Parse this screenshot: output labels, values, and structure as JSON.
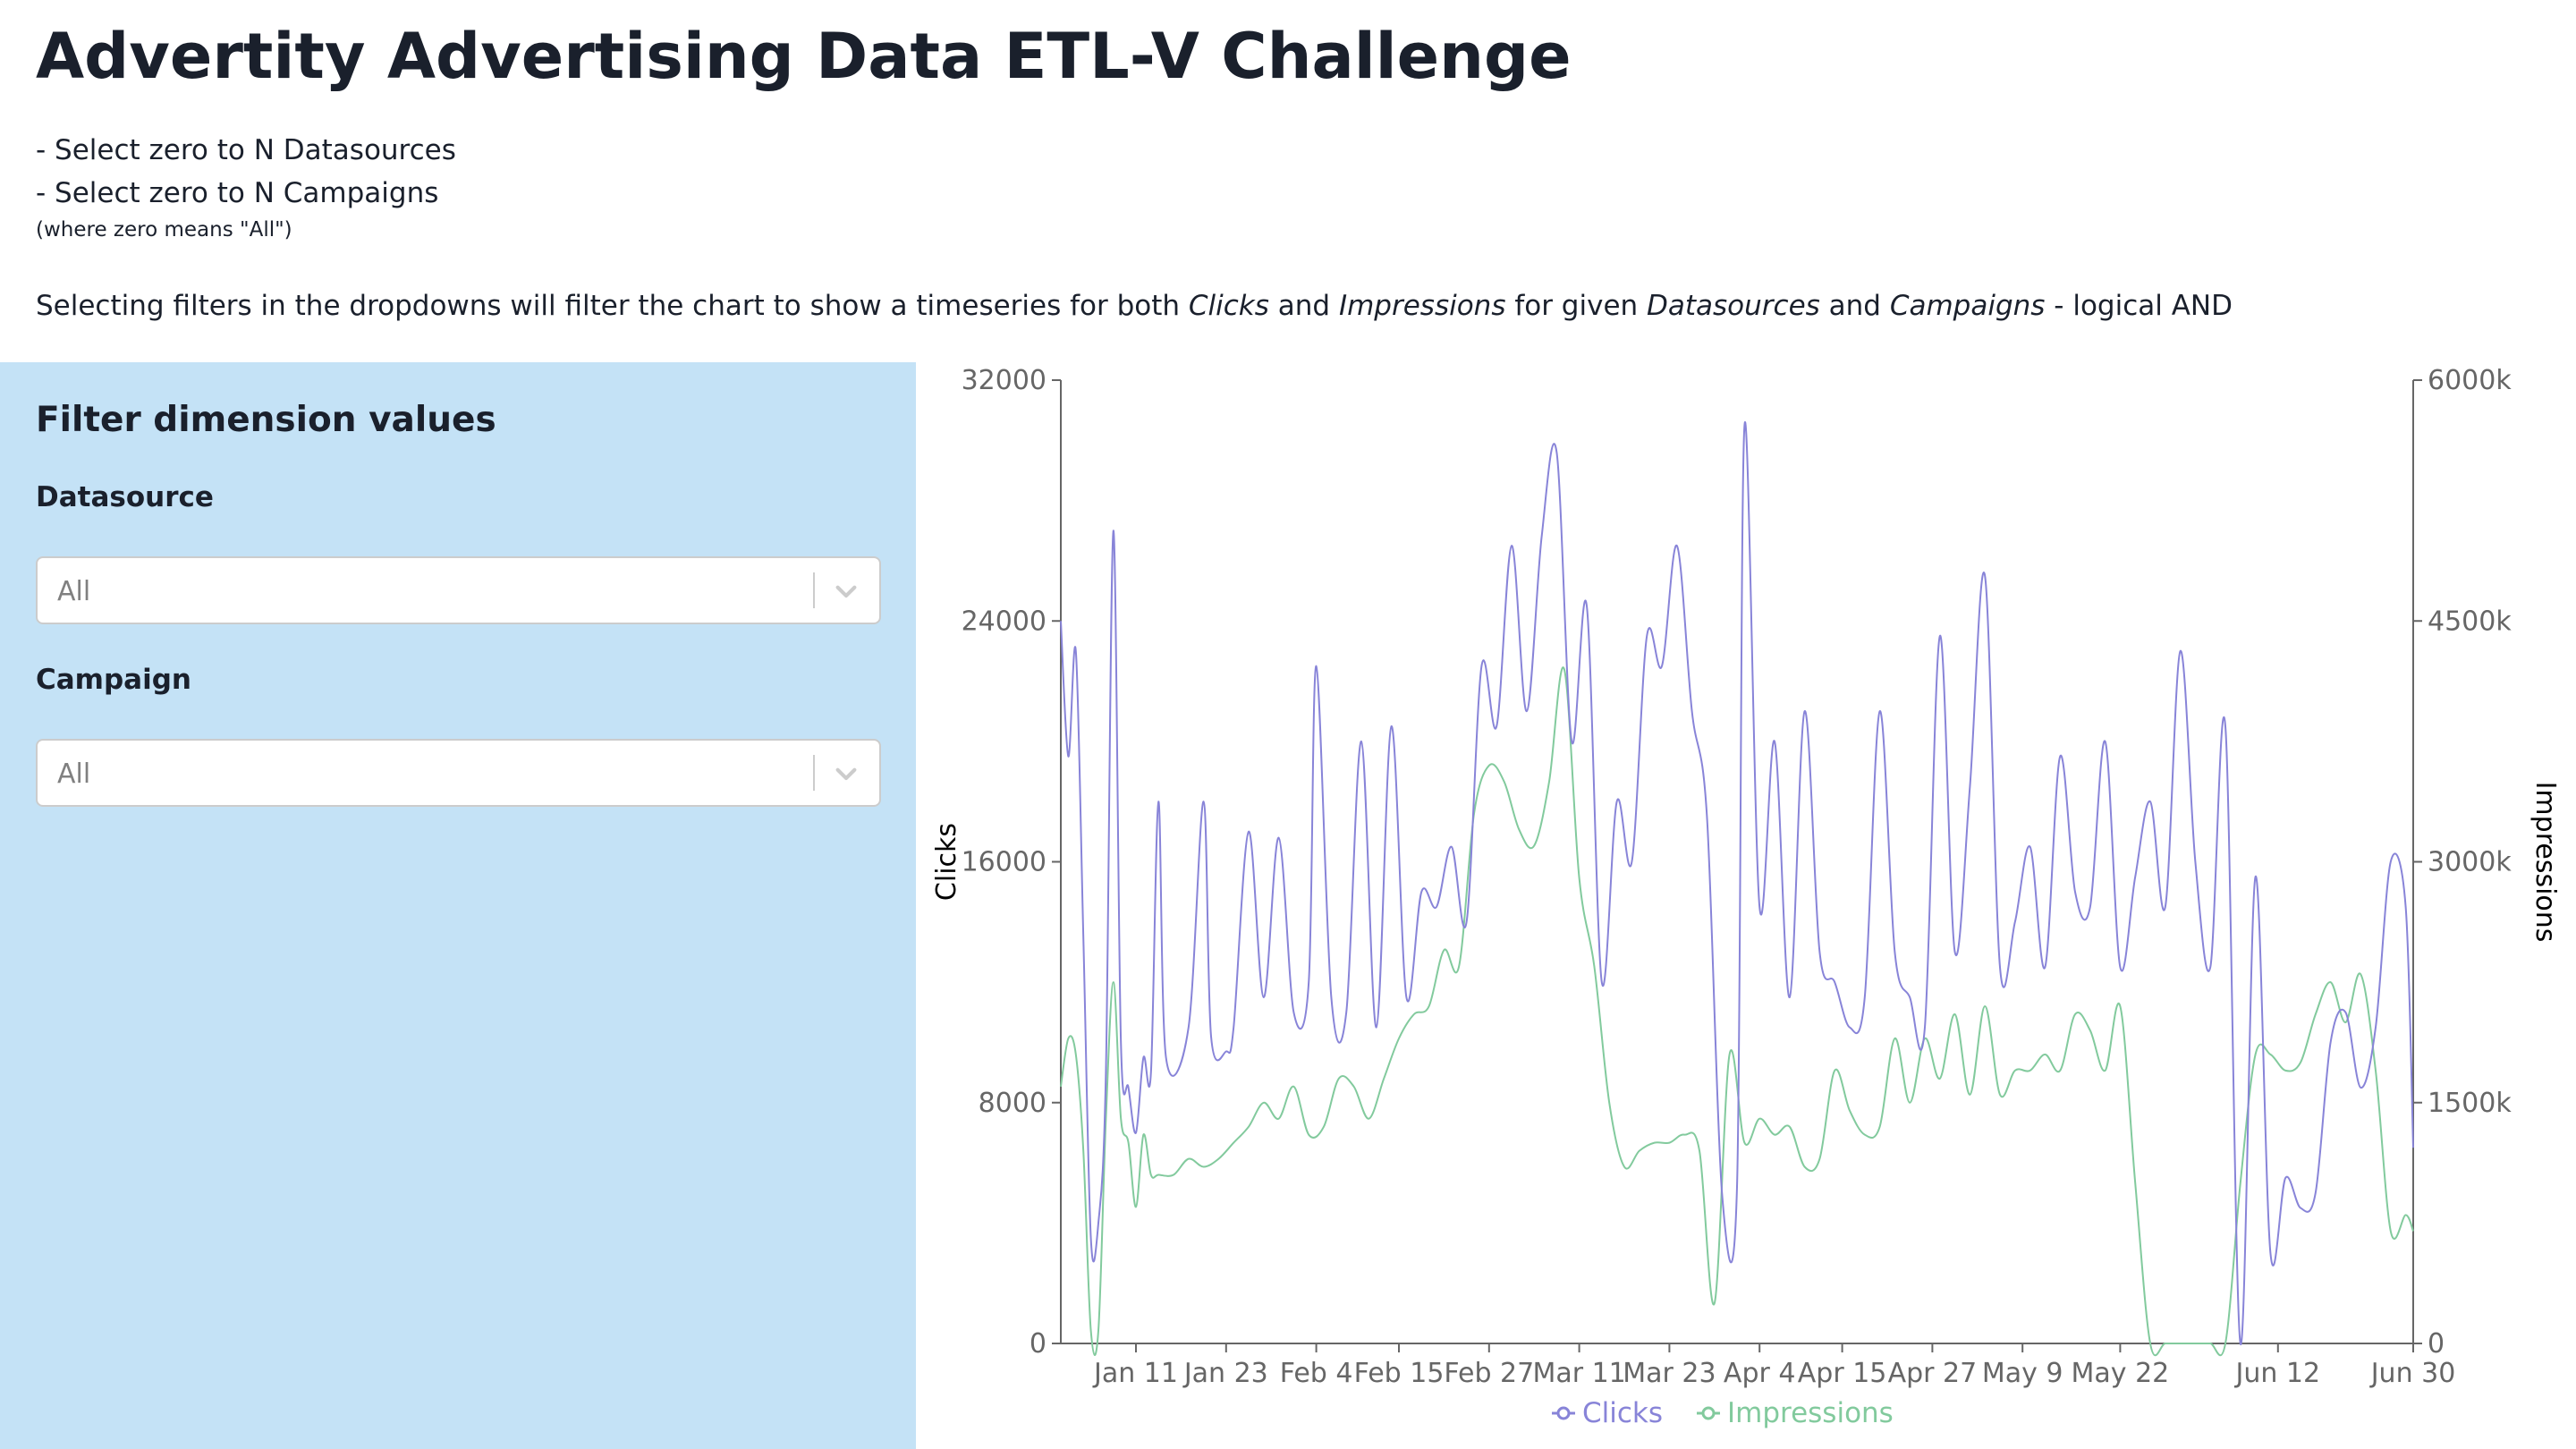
{
  "page": {
    "title": "Advertity Advertising Data ETL-V Challenge",
    "instructions": [
      "- Select zero to N Datasources",
      "- Select zero to N Campaigns"
    ],
    "note": "(where zero means \"All\")",
    "description": {
      "p1": "Selecting filters in the dropdowns will filter the chart to show a timeseries for both ",
      "clicks": "Clicks",
      "and1": " and ",
      "impressions": "Impressions",
      "p2": " for given ",
      "datasources": "Datasources",
      "and2": " and ",
      "campaigns": "Campaigns",
      "p3": " - logical AND"
    }
  },
  "sidebar": {
    "title": "Filter dimension values",
    "datasource": {
      "label": "Datasource",
      "value": "All"
    },
    "campaign": {
      "label": "Campaign",
      "value": "All"
    },
    "background": "#c4e2f6"
  },
  "icons": {
    "dropdown": "chevron-down-icon",
    "legend": "line-circle-marker-icon"
  },
  "chart_data": {
    "type": "line",
    "x_unit": "date (2019)",
    "x_ticks": [
      "Jan 11",
      "Jan 23",
      "Feb 4",
      "Feb 15",
      "Feb 27",
      "Mar 11",
      "Mar 23",
      "Apr 4",
      "Apr 15",
      "Apr 27",
      "May 9",
      "May 22",
      "Jun 12",
      "Jun 30"
    ],
    "x_tick_dates": [
      "2019-01-11",
      "2019-01-23",
      "2019-02-04",
      "2019-02-15",
      "2019-02-27",
      "2019-03-11",
      "2019-03-23",
      "2019-04-04",
      "2019-04-15",
      "2019-04-27",
      "2019-05-09",
      "2019-05-22",
      "2019-06-12",
      "2019-06-30"
    ],
    "xlim": [
      "2019-01-01",
      "2019-06-30"
    ],
    "y_left": {
      "label": "Clicks",
      "ylim": [
        0,
        32000
      ],
      "ticks": [
        "0",
        "8000",
        "16000",
        "24000",
        "32000"
      ]
    },
    "y_right": {
      "label": "Impressions",
      "ylim": [
        0,
        6000000
      ],
      "ticks": [
        "0",
        "1500k",
        "3000k",
        "4500k",
        "6000k"
      ]
    },
    "legend": "bottom-center",
    "grid": false,
    "series": [
      {
        "name": "Clicks",
        "axis": "left",
        "color": "#8884d8",
        "x": [
          "2019-01-01",
          "2019-01-02",
          "2019-01-03",
          "2019-01-04",
          "2019-01-05",
          "2019-01-06",
          "2019-01-07",
          "2019-01-08",
          "2019-01-09",
          "2019-01-10",
          "2019-01-11",
          "2019-01-12",
          "2019-01-13",
          "2019-01-14",
          "2019-01-15",
          "2019-01-18",
          "2019-01-20",
          "2019-01-21",
          "2019-01-23",
          "2019-01-24",
          "2019-01-26",
          "2019-01-28",
          "2019-01-30",
          "2019-02-01",
          "2019-02-03",
          "2019-02-04",
          "2019-02-06",
          "2019-02-08",
          "2019-02-10",
          "2019-02-12",
          "2019-02-14",
          "2019-02-16",
          "2019-02-18",
          "2019-02-20",
          "2019-02-22",
          "2019-02-24",
          "2019-02-26",
          "2019-02-28",
          "2019-03-02",
          "2019-03-04",
          "2019-03-06",
          "2019-03-08",
          "2019-03-10",
          "2019-03-12",
          "2019-03-14",
          "2019-03-16",
          "2019-03-18",
          "2019-03-20",
          "2019-03-22",
          "2019-03-24",
          "2019-03-26",
          "2019-03-28",
          "2019-03-30",
          "2019-04-01",
          "2019-04-02",
          "2019-04-04",
          "2019-04-06",
          "2019-04-08",
          "2019-04-10",
          "2019-04-12",
          "2019-04-14",
          "2019-04-16",
          "2019-04-18",
          "2019-04-20",
          "2019-04-22",
          "2019-04-24",
          "2019-04-26",
          "2019-04-28",
          "2019-04-30",
          "2019-05-02",
          "2019-05-04",
          "2019-05-06",
          "2019-05-08",
          "2019-05-10",
          "2019-05-12",
          "2019-05-14",
          "2019-05-16",
          "2019-05-18",
          "2019-05-20",
          "2019-05-22",
          "2019-05-24",
          "2019-05-26",
          "2019-05-28",
          "2019-05-30",
          "2019-06-01",
          "2019-06-03",
          "2019-06-05",
          "2019-06-07",
          "2019-06-09",
          "2019-06-11",
          "2019-06-13",
          "2019-06-15",
          "2019-06-17",
          "2019-06-19",
          "2019-06-21",
          "2019-06-23",
          "2019-06-25",
          "2019-06-27",
          "2019-06-29",
          "2019-06-30"
        ],
        "values": [
          24000,
          19500,
          23000,
          13500,
          3500,
          4000,
          9000,
          27000,
          10000,
          8500,
          7000,
          9500,
          9000,
          18000,
          9500,
          10500,
          18000,
          10200,
          9700,
          10500,
          17000,
          11500,
          16800,
          11000,
          12000,
          22500,
          11500,
          11000,
          20000,
          10500,
          20500,
          11500,
          15000,
          14500,
          16500,
          14000,
          22500,
          20500,
          26500,
          21000,
          26800,
          29600,
          20000,
          24500,
          12000,
          18000,
          16000,
          23500,
          22500,
          26500,
          21000,
          17500,
          5000,
          5200,
          30500,
          14500,
          20000,
          11500,
          21000,
          13000,
          12000,
          10500,
          11500,
          21000,
          13000,
          11500,
          10500,
          23500,
          13000,
          18500,
          25500,
          12500,
          14000,
          16500,
          12500,
          19500,
          15000,
          14500,
          20000,
          12500,
          15500,
          18000,
          14500,
          23000,
          16000,
          12500,
          20500,
          0,
          15500,
          3000,
          5500,
          4500,
          5000,
          10000,
          11000,
          8500,
          10500,
          16000,
          14500,
          6500
        ]
      },
      {
        "name": "Impressions",
        "axis": "right",
        "color": "#82ca9d",
        "x": [
          "2019-01-01",
          "2019-01-02",
          "2019-01-03",
          "2019-01-04",
          "2019-01-05",
          "2019-01-06",
          "2019-01-07",
          "2019-01-08",
          "2019-01-09",
          "2019-01-10",
          "2019-01-11",
          "2019-01-12",
          "2019-01-13",
          "2019-01-14",
          "2019-01-16",
          "2019-01-18",
          "2019-01-20",
          "2019-01-22",
          "2019-01-24",
          "2019-01-26",
          "2019-01-28",
          "2019-01-30",
          "2019-02-01",
          "2019-02-03",
          "2019-02-05",
          "2019-02-07",
          "2019-02-09",
          "2019-02-11",
          "2019-02-13",
          "2019-02-15",
          "2019-02-17",
          "2019-02-19",
          "2019-02-21",
          "2019-02-23",
          "2019-02-25",
          "2019-02-27",
          "2019-03-01",
          "2019-03-03",
          "2019-03-05",
          "2019-03-07",
          "2019-03-09",
          "2019-03-11",
          "2019-03-13",
          "2019-03-15",
          "2019-03-17",
          "2019-03-19",
          "2019-03-21",
          "2019-03-23",
          "2019-03-25",
          "2019-03-27",
          "2019-03-29",
          "2019-03-31",
          "2019-04-02",
          "2019-04-04",
          "2019-04-06",
          "2019-04-08",
          "2019-04-10",
          "2019-04-12",
          "2019-04-14",
          "2019-04-16",
          "2019-04-18",
          "2019-04-20",
          "2019-04-22",
          "2019-04-24",
          "2019-04-26",
          "2019-04-28",
          "2019-04-30",
          "2019-05-02",
          "2019-05-04",
          "2019-05-06",
          "2019-05-08",
          "2019-05-10",
          "2019-05-12",
          "2019-05-14",
          "2019-05-16",
          "2019-05-18",
          "2019-05-20",
          "2019-05-22",
          "2019-05-24",
          "2019-05-26",
          "2019-05-28",
          "2019-05-30",
          "2019-06-01",
          "2019-06-03",
          "2019-06-05",
          "2019-06-07",
          "2019-06-09",
          "2019-06-11",
          "2019-06-13",
          "2019-06-15",
          "2019-06-17",
          "2019-06-19",
          "2019-06-21",
          "2019-06-23",
          "2019-06-25",
          "2019-06-27",
          "2019-06-29",
          "2019-06-30"
        ],
        "values": [
          1600000,
          1900000,
          1800000,
          1200000,
          80000,
          80000,
          1400000,
          2250000,
          1400000,
          1250000,
          850000,
          1300000,
          1050000,
          1050000,
          1050000,
          1150000,
          1100000,
          1150000,
          1250000,
          1350000,
          1500000,
          1400000,
          1600000,
          1300000,
          1350000,
          1650000,
          1600000,
          1400000,
          1650000,
          1900000,
          2050000,
          2100000,
          2450000,
          2350000,
          3300000,
          3600000,
          3500000,
          3200000,
          3100000,
          3500000,
          4200000,
          2900000,
          2350000,
          1500000,
          1100000,
          1200000,
          1250000,
          1250000,
          1300000,
          1200000,
          250000,
          1800000,
          1250000,
          1400000,
          1300000,
          1350000,
          1100000,
          1150000,
          1700000,
          1450000,
          1300000,
          1350000,
          1900000,
          1500000,
          1900000,
          1650000,
          2050000,
          1550000,
          2100000,
          1550000,
          1700000,
          1700000,
          1800000,
          1700000,
          2050000,
          1950000,
          1700000,
          2100000,
          1000000,
          0,
          0,
          0,
          0,
          0,
          0,
          1000000,
          1800000,
          1800000,
          1700000,
          1750000,
          2050000,
          2250000,
          2000000,
          2300000,
          1700000,
          700000,
          800000,
          700000
        ]
      }
    ]
  }
}
